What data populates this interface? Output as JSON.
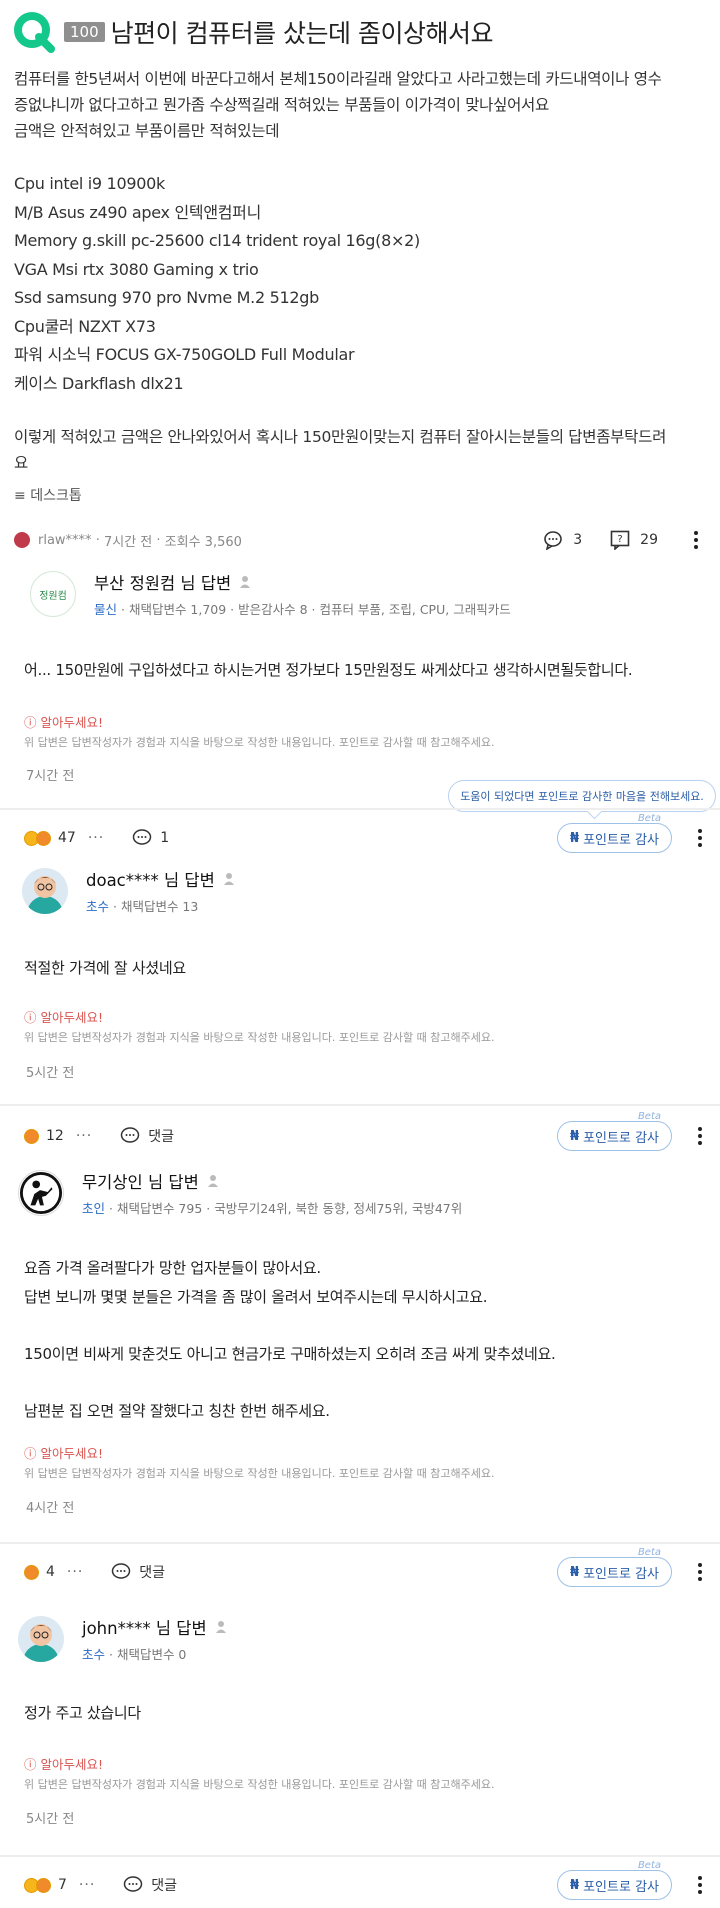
{
  "question": {
    "badge": "100",
    "title": "남편이 컴퓨터를 샀는데 좀이상해서요",
    "lines": [
      "컴퓨터를 한5년써서 이번에 바꾼다고해서 본체150이라길래 알았다고 사라고했는데 카드내역이나 영수",
      "증없냐니까 없다고하고 뭔가좀 수상쩍길래 적혀있는 부품들이 이가격이 맞나싶어서요",
      "금액은 안적혀있고 부품이름만 적혀있는데"
    ],
    "specs": [
      "Cpu intel i9 10900k",
      "M/B Asus z490 apex 인텍앤컴퍼니",
      "Memory g.skill pc-25600 cl14 trident royal 16g(8×2)",
      "VGA Msi rtx 3080 Gaming x trio",
      "Ssd samsung 970 pro Nvme M.2 512gb",
      "Cpu쿨러 NZXT X73",
      "파워 시소닉 FOCUS GX-750GOLD Full Modular",
      "케이스 Darkflash dlx21"
    ],
    "closing": [
      "이렇게 적혀있고 금액은 안나와있어서 혹시나 150만원이맞는지 컴퓨터 잘아시는분들의 답변좀부탁드려",
      "요"
    ],
    "tag": "데스크톱",
    "meta": {
      "author": "rlaw****",
      "time": "7시간 전",
      "views": "조회수 3,560",
      "comments": "3",
      "answers": "29"
    }
  },
  "notice": {
    "title": "알아두세요!",
    "desc": "위 답변은 답변작성자가 경험과 지식을 바탕으로 작성한 내용입니다. 포인트로 감사할 때 참고해주세요."
  },
  "tooltip": "도움이 되었다면 포인트로 감사한 마음을 전해보세요.",
  "point_label": "포인트로 감사",
  "beta": "Beta",
  "comment_label": "댓글",
  "answers": [
    {
      "name": "부산 정원컴 님 답변",
      "avatar_text": "정원컴",
      "level": "물신",
      "sub": "채택답변수 1,709 · 받은감사수 8 · 컴퓨터 부품, 조립, CPU, 그래픽카드",
      "text": [
        "어... 150만원에 구입하셨다고 하시는거면 정가보다 15만원정도 싸게샀다고 생각하시면될듯합니다."
      ],
      "time": "7시간 전",
      "reactions": "47",
      "comments": "1"
    },
    {
      "name": "doac**** 님 답변",
      "level": "초수",
      "sub": "채택답변수 13",
      "text": [
        "적절한 가격에 잘 사셨네요"
      ],
      "time": "5시간 전",
      "reactions": "12"
    },
    {
      "name": "무기상인 님 답변",
      "level": "초인",
      "sub": "채택답변수 795 · 국방무기24위, 북한 동향, 정세75위, 국방47위",
      "text": [
        "요즘 가격 올려팔다가 망한 업자분들이 많아서요.",
        "답변 보니까 몇몇 분들은 가격을 좀 많이 올려서 보여주시는데 무시하시고요.",
        "",
        "150이면 비싸게 맞춘것도 아니고 현금가로 구매하셨는지 오히려 조금 싸게 맞추셨네요.",
        "",
        "남편분 집 오면 절약 잘했다고 칭찬 한번 해주세요."
      ],
      "time": "4시간 전",
      "reactions": "4"
    },
    {
      "name": "john**** 님 답변",
      "level": "초수",
      "sub": "채택답변수 0",
      "text": [
        "정가 주고 샀습니다"
      ],
      "time": "5시간 전",
      "reactions": "7"
    }
  ]
}
